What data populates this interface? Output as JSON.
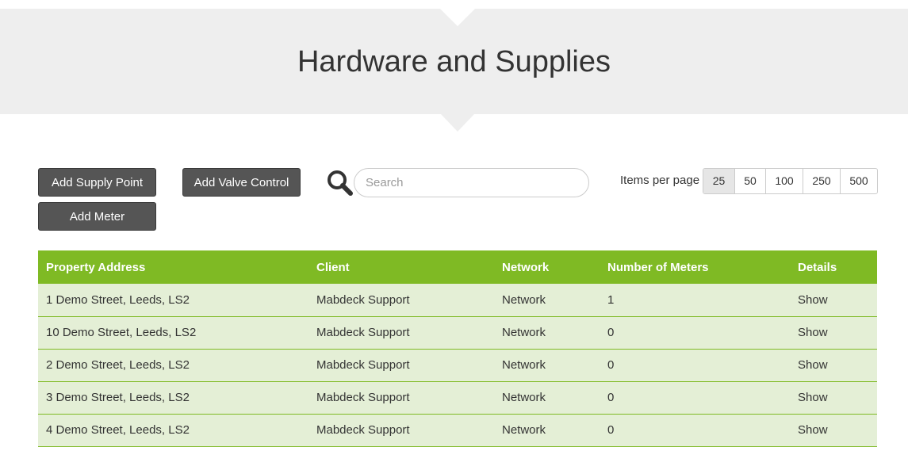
{
  "header": {
    "title": "Hardware and Supplies"
  },
  "toolbar": {
    "add_supply_point_label": "Add Supply Point",
    "add_valve_control_label": "Add Valve Control",
    "add_meter_label": "Add Meter",
    "search_placeholder": "Search",
    "search_value": "",
    "items_per_page_label": "Items per page",
    "page_sizes": [
      "25",
      "50",
      "100",
      "250",
      "500"
    ],
    "selected_page_size": "25"
  },
  "table": {
    "headers": [
      "Property Address",
      "Client",
      "Network",
      "Number of Meters",
      "Details"
    ],
    "rows": [
      {
        "address": "1 Demo Street, Leeds, LS2",
        "client": "Mabdeck Support",
        "network": "Network",
        "meters": "1",
        "details": "Show"
      },
      {
        "address": "10 Demo Street, Leeds, LS2",
        "client": "Mabdeck Support",
        "network": "Network",
        "meters": "0",
        "details": "Show"
      },
      {
        "address": "2 Demo Street, Leeds, LS2",
        "client": "Mabdeck Support",
        "network": "Network",
        "meters": "0",
        "details": "Show"
      },
      {
        "address": "3 Demo Street, Leeds, LS2",
        "client": "Mabdeck Support",
        "network": "Network",
        "meters": "0",
        "details": "Show"
      },
      {
        "address": "4 Demo Street, Leeds, LS2",
        "client": "Mabdeck Support",
        "network": "Network",
        "meters": "0",
        "details": "Show"
      }
    ]
  },
  "colors": {
    "header_green": "#7fba24",
    "row_green": "#e4efd6",
    "button_dark": "#555555",
    "hero_gray": "#eeeeee"
  },
  "icons": {
    "search": "search-icon"
  }
}
